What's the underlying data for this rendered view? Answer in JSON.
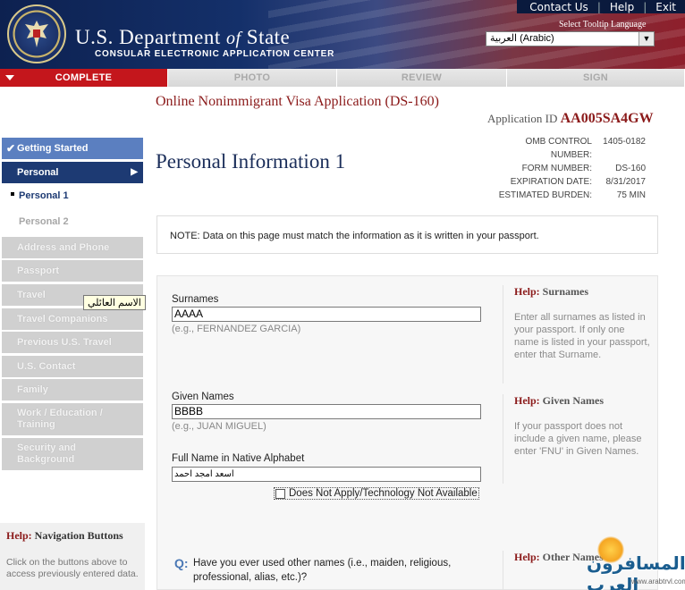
{
  "header": {
    "links": [
      "Contact Us",
      "Help",
      "Exit"
    ],
    "title_a": "U.S. Department",
    "title_of": "of",
    "title_b": "State",
    "subtitle": "CONSULAR ELECTRONIC APPLICATION CENTER",
    "tooltip_language_label": "Select Tooltip Language",
    "tooltip_language_value": "العربية (Arabic)"
  },
  "tabs": [
    "COMPLETE",
    "PHOTO",
    "REVIEW",
    "SIGN"
  ],
  "form_title": "Online Nonimmigrant Visa Application (DS-160)",
  "application_id_label": "Application ID",
  "application_id": "AA005SA4GW",
  "omb": [
    {
      "k": "OMB CONTROL NUMBER:",
      "v": "1405-0182"
    },
    {
      "k": "FORM NUMBER:",
      "v": "DS-160"
    },
    {
      "k": "EXPIRATION DATE:",
      "v": "8/31/2017"
    },
    {
      "k": "ESTIMATED BURDEN:",
      "v": "75 MIN"
    }
  ],
  "page_title": "Personal Information 1",
  "sidebar": {
    "getting_started": "Getting Started",
    "personal": "Personal",
    "personal1": "Personal 1",
    "personal2": "Personal 2",
    "address_phone": "Address and Phone",
    "passport": "Passport",
    "travel": "Travel",
    "travel_companions": "Travel Companions",
    "previous_travel": "Previous U.S. Travel",
    "us_contact": "U.S. Contact",
    "family": "Family",
    "work_edu_1": "Work / Education /",
    "work_edu_2": "Training",
    "security_1": "Security and",
    "security_2": "Background"
  },
  "tooltip": "الاسم العائلي",
  "help_nav": {
    "label": "Help:",
    "title": "Navigation Buttons",
    "text": "Click on the buttons above to access previously entered data."
  },
  "note": "NOTE: Data on this page must match the information as it is written in your passport.",
  "fields": {
    "surnames_label": "Surnames",
    "surnames_value": "AAAA",
    "surnames_example": "(e.g., FERNANDEZ GARCIA)",
    "given_label": "Given Names",
    "given_value": "BBBB",
    "given_example": "(e.g., JUAN MIGUEL)",
    "native_label": "Full Name in Native Alphabet",
    "native_value": "اسعد امجد احمد",
    "dna_label": "Does Not Apply/Technology Not Available"
  },
  "help": {
    "label": "Help:",
    "surnames_title": "Surnames",
    "surnames_text": "Enter all surnames as listed in your passport. If only one name is listed in your passport, enter that Surname.",
    "given_title": "Given Names",
    "given_text": "If your passport does not include a given name, please enter 'FNU' in Given Names.",
    "other_title": "Other Names"
  },
  "question": {
    "mark": "Q:",
    "text": "Have you ever used other names (i.e., maiden, religious, professional, alias, etc.)?"
  },
  "watermark": {
    "arabic": "المسافرون العرب",
    "url": "www.arabtrvl.com"
  }
}
